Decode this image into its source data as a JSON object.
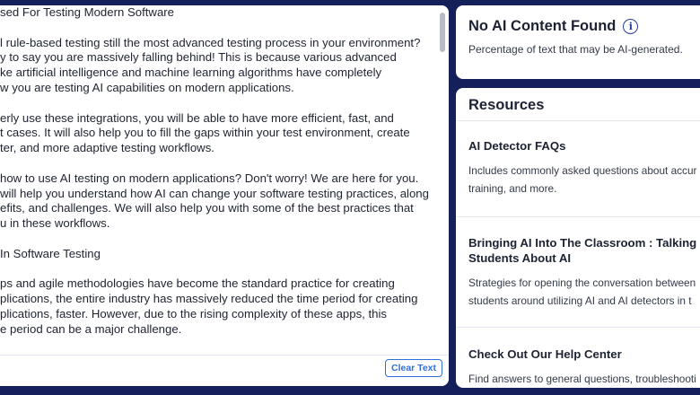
{
  "editor": {
    "lines": [
      "sed For Testing Modern Software",
      "",
      "l rule-based testing still the most advanced testing process in your environment?",
      "y to say you are massively falling behind! This is because various advanced",
      "ke artificial intelligence and machine learning algorithms have completely",
      "w you are testing AI capabilities on modern applications.",
      "",
      "erly use these integrations, you will be able to have more efficient, fast, and",
      "t cases. It will also help you to fill the gaps within your test environment, create",
      "ter, and more adaptive testing workflows.",
      "",
      "how to use AI testing on modern applications? Don't worry! We are here for you.",
      "will help you understand how AI can change your software testing practices, along",
      "efits, and challenges. We will also help you with some of the best practices that",
      "u in these workflows.",
      "",
      "In Software Testing",
      "",
      "ps and agile methodologies have become the standard practice for creating",
      "plications, the entire industry has massively reduced the time period for creating",
      "plications, faster. However, due to the rising complexity of these apps, this",
      "e period can be a major challenge."
    ],
    "clear_label": "Clear Text"
  },
  "result": {
    "title": "No AI Content Found",
    "description": "Percentage of text that may be AI-generated."
  },
  "resources": {
    "heading": "Resources",
    "items": [
      {
        "title_lines": [
          "AI Detector FAQs"
        ],
        "desc_lines": [
          "Includes commonly asked questions about accur",
          "training, and more."
        ]
      },
      {
        "title_lines": [
          "Bringing AI Into The Classroom : Talking T",
          "Students About AI"
        ],
        "desc_lines": [
          "Strategies for opening the conversation between",
          "students around utilizing AI and AI detectors in t"
        ]
      },
      {
        "title_lines": [
          "Check Out Our Help Center"
        ],
        "desc_lines": [
          "Find answers to general questions, troubleshooti"
        ]
      }
    ]
  },
  "colors": {
    "background": "#15205a",
    "accent": "#2f6fdc",
    "info_icon": "#2a3ca0"
  },
  "icons": {
    "info": "info-icon"
  }
}
